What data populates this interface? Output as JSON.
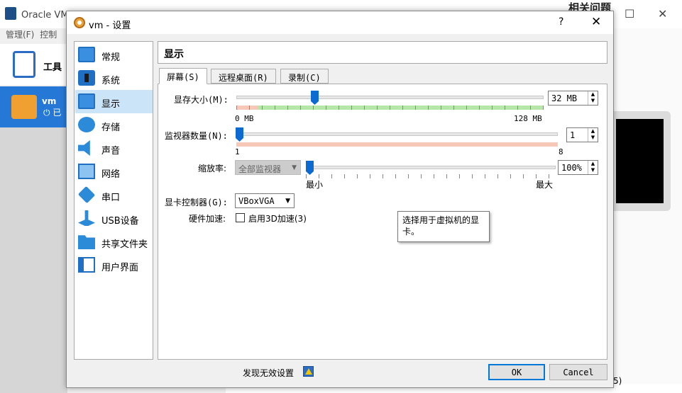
{
  "background": {
    "app_title": "Oracle VM",
    "menu_items": [
      "管理(F)",
      "控制"
    ],
    "tools_label": "工具",
    "vm_name": "vm",
    "vm_state": "已",
    "right_title": "相关问题",
    "bottom_fragment": "5)"
  },
  "dialog": {
    "title": "vm - 设置",
    "help": "?",
    "close": "✕",
    "nav_items": [
      {
        "label": "常规",
        "icon": "monitor-icon"
      },
      {
        "label": "系统",
        "icon": "chip-icon"
      },
      {
        "label": "显示",
        "icon": "display-icon"
      },
      {
        "label": "存储",
        "icon": "storage-icon"
      },
      {
        "label": "声音",
        "icon": "speaker-icon"
      },
      {
        "label": "网络",
        "icon": "network-icon"
      },
      {
        "label": "串口",
        "icon": "serial-icon"
      },
      {
        "label": "USB设备",
        "icon": "usb-icon"
      },
      {
        "label": "共享文件夹",
        "icon": "folder-icon"
      },
      {
        "label": "用户界面",
        "icon": "ui-icon"
      }
    ],
    "selected_nav": "显示",
    "section_title": "显示",
    "tabs": [
      "屏幕(S)",
      "远程桌面(R)",
      "录制(C)"
    ],
    "active_tab": "屏幕(S)",
    "screen": {
      "video_memory_label": "显存大小(M):",
      "video_memory_value": "32 MB",
      "video_memory_min": "0 MB",
      "video_memory_max": "128 MB",
      "video_memory_fraction": 0.25,
      "monitors_label": "监视器数量(N):",
      "monitors_value": "1",
      "monitors_min": "1",
      "monitors_max": "8",
      "scale_label": "缩放率:",
      "scale_combo": "全部监视器",
      "scale_value": "100%",
      "scale_min": "最小",
      "scale_max": "最大",
      "graphics_controller_label": "显卡控制器(G):",
      "graphics_controller_value": "VBoxVGA",
      "hw_accel_label": "硬件加速:",
      "hw_accel_checkbox": "启用3D加速(3)",
      "hw_accel_checked": false
    },
    "tooltip": "选择用于虚拟机的显卡。",
    "footer": {
      "invalid_settings": "发现无效设置",
      "ok": "OK",
      "cancel": "Cancel"
    }
  }
}
